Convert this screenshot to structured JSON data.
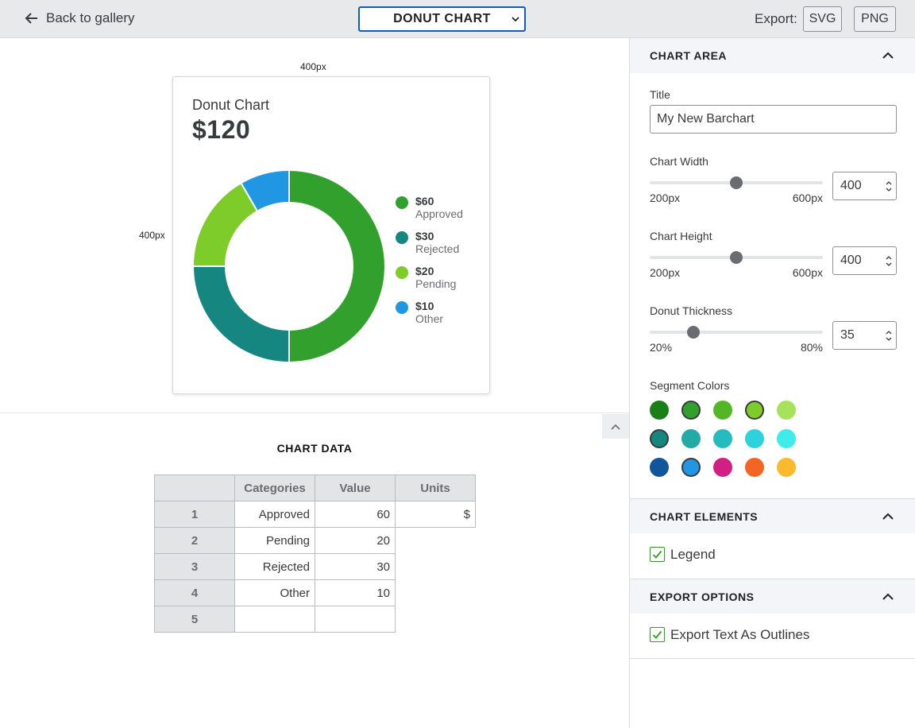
{
  "topbar": {
    "back_label": "Back to gallery",
    "chart_type": "DONUT CHART",
    "export_label": "Export:",
    "export_svg": "SVG",
    "export_png": "PNG"
  },
  "canvas": {
    "width_label": "400px",
    "height_label": "400px"
  },
  "chart_card": {
    "title": "Donut Chart",
    "total": "$120",
    "legend": [
      {
        "value": "$60",
        "label": "Approved",
        "color": "#32a02c"
      },
      {
        "value": "$30",
        "label": "Rejected",
        "color": "#158680"
      },
      {
        "value": "$20",
        "label": "Pending",
        "color": "#7ecc2a"
      },
      {
        "value": "$10",
        "label": "Other",
        "color": "#2196e3"
      }
    ]
  },
  "chart_data": {
    "type": "pie",
    "title": "Donut Chart",
    "categories": [
      "Approved",
      "Rejected",
      "Pending",
      "Other"
    ],
    "values": [
      60,
      30,
      20,
      10
    ],
    "colors": [
      "#32a02c",
      "#158680",
      "#7ecc2a",
      "#2196e3"
    ],
    "units": "$",
    "total": 120,
    "donut_thickness": 35,
    "legend_position": "right"
  },
  "data_table": {
    "heading": "CHART DATA",
    "columns": [
      "Categories",
      "Value",
      "Units"
    ],
    "rows": [
      {
        "num": "1",
        "category": "Approved",
        "value": "60",
        "units": "$"
      },
      {
        "num": "2",
        "category": "Pending",
        "value": "20"
      },
      {
        "num": "3",
        "category": "Rejected",
        "value": "30"
      },
      {
        "num": "4",
        "category": "Other",
        "value": "10"
      },
      {
        "num": "5",
        "category": "",
        "value": ""
      }
    ]
  },
  "panel": {
    "chart_area": {
      "heading": "CHART AREA",
      "title_label": "Title",
      "title_value": "My New Barchart",
      "width_label": "Chart Width",
      "width_value": "400",
      "width_min": "200px",
      "width_max": "600px",
      "width_fraction": 0.5,
      "height_label": "Chart Height",
      "height_value": "400",
      "height_min": "200px",
      "height_max": "600px",
      "height_fraction": 0.5,
      "thickness_label": "Donut Thickness",
      "thickness_value": "35",
      "thickness_min": "20%",
      "thickness_max": "80%",
      "thickness_fraction": 0.25,
      "colors_label": "Segment Colors",
      "swatches": [
        [
          "#1a7f17",
          "#32a02c",
          "#53b626",
          "#7ecc2a",
          "#a8e25a"
        ],
        [
          "#158680",
          "#21aaa6",
          "#25bcc0",
          "#2cd3dc",
          "#3eedeb"
        ],
        [
          "#11559a",
          "#2196e3",
          "#d21f82",
          "#f46524",
          "#fbb92e"
        ]
      ],
      "selected_swatches": [
        "#32a02c",
        "#7ecc2a",
        "#158680",
        "#2196e3"
      ]
    },
    "chart_elements": {
      "heading": "CHART ELEMENTS",
      "legend_label": "Legend",
      "legend_checked": true
    },
    "export_options": {
      "heading": "EXPORT OPTIONS",
      "outlines_label": "Export Text As Outlines",
      "outlines_checked": true
    }
  }
}
